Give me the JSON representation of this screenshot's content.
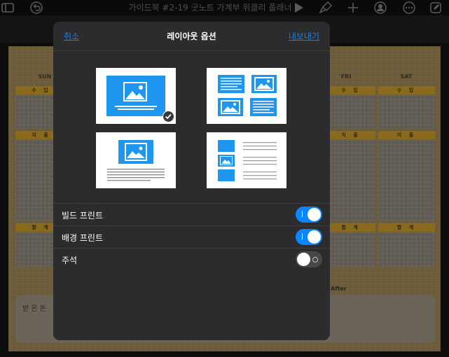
{
  "app": {
    "title": "가이드북 #2-19 굿노트 가계부 위클리 플래너"
  },
  "toolbar": {
    "icons": [
      "sidebar-icon",
      "undo-icon",
      "play-icon",
      "brush-icon",
      "add-icon",
      "share-person-icon",
      "more-icon",
      "edit-icon"
    ]
  },
  "document": {
    "days": [
      "SUN",
      "FRI",
      "SAT"
    ],
    "bands": [
      "수 입",
      "수 입",
      "수 입",
      "지 출",
      "지 출",
      "지 출",
      "합 계",
      "합 계",
      "합 계"
    ],
    "received_label": "받 은 돈",
    "after_label": "After"
  },
  "modal": {
    "cancel_label": "취소",
    "title": "레이아웃 옵션",
    "export_label": "내보내기",
    "layout_options": [
      "slide-only",
      "slide-with-notes",
      "two-by-two-grid",
      "outline-list"
    ],
    "selected_layout": "slide-only",
    "settings": [
      {
        "label": "빌드 프린트",
        "on": true
      },
      {
        "label": "배경 프린트",
        "on": true
      },
      {
        "label": "주석",
        "on": false
      }
    ]
  },
  "colors": {
    "accent": "#0a84ff",
    "thumb_blue": "#1e96f0",
    "modal_bg": "#2c2c2e"
  }
}
